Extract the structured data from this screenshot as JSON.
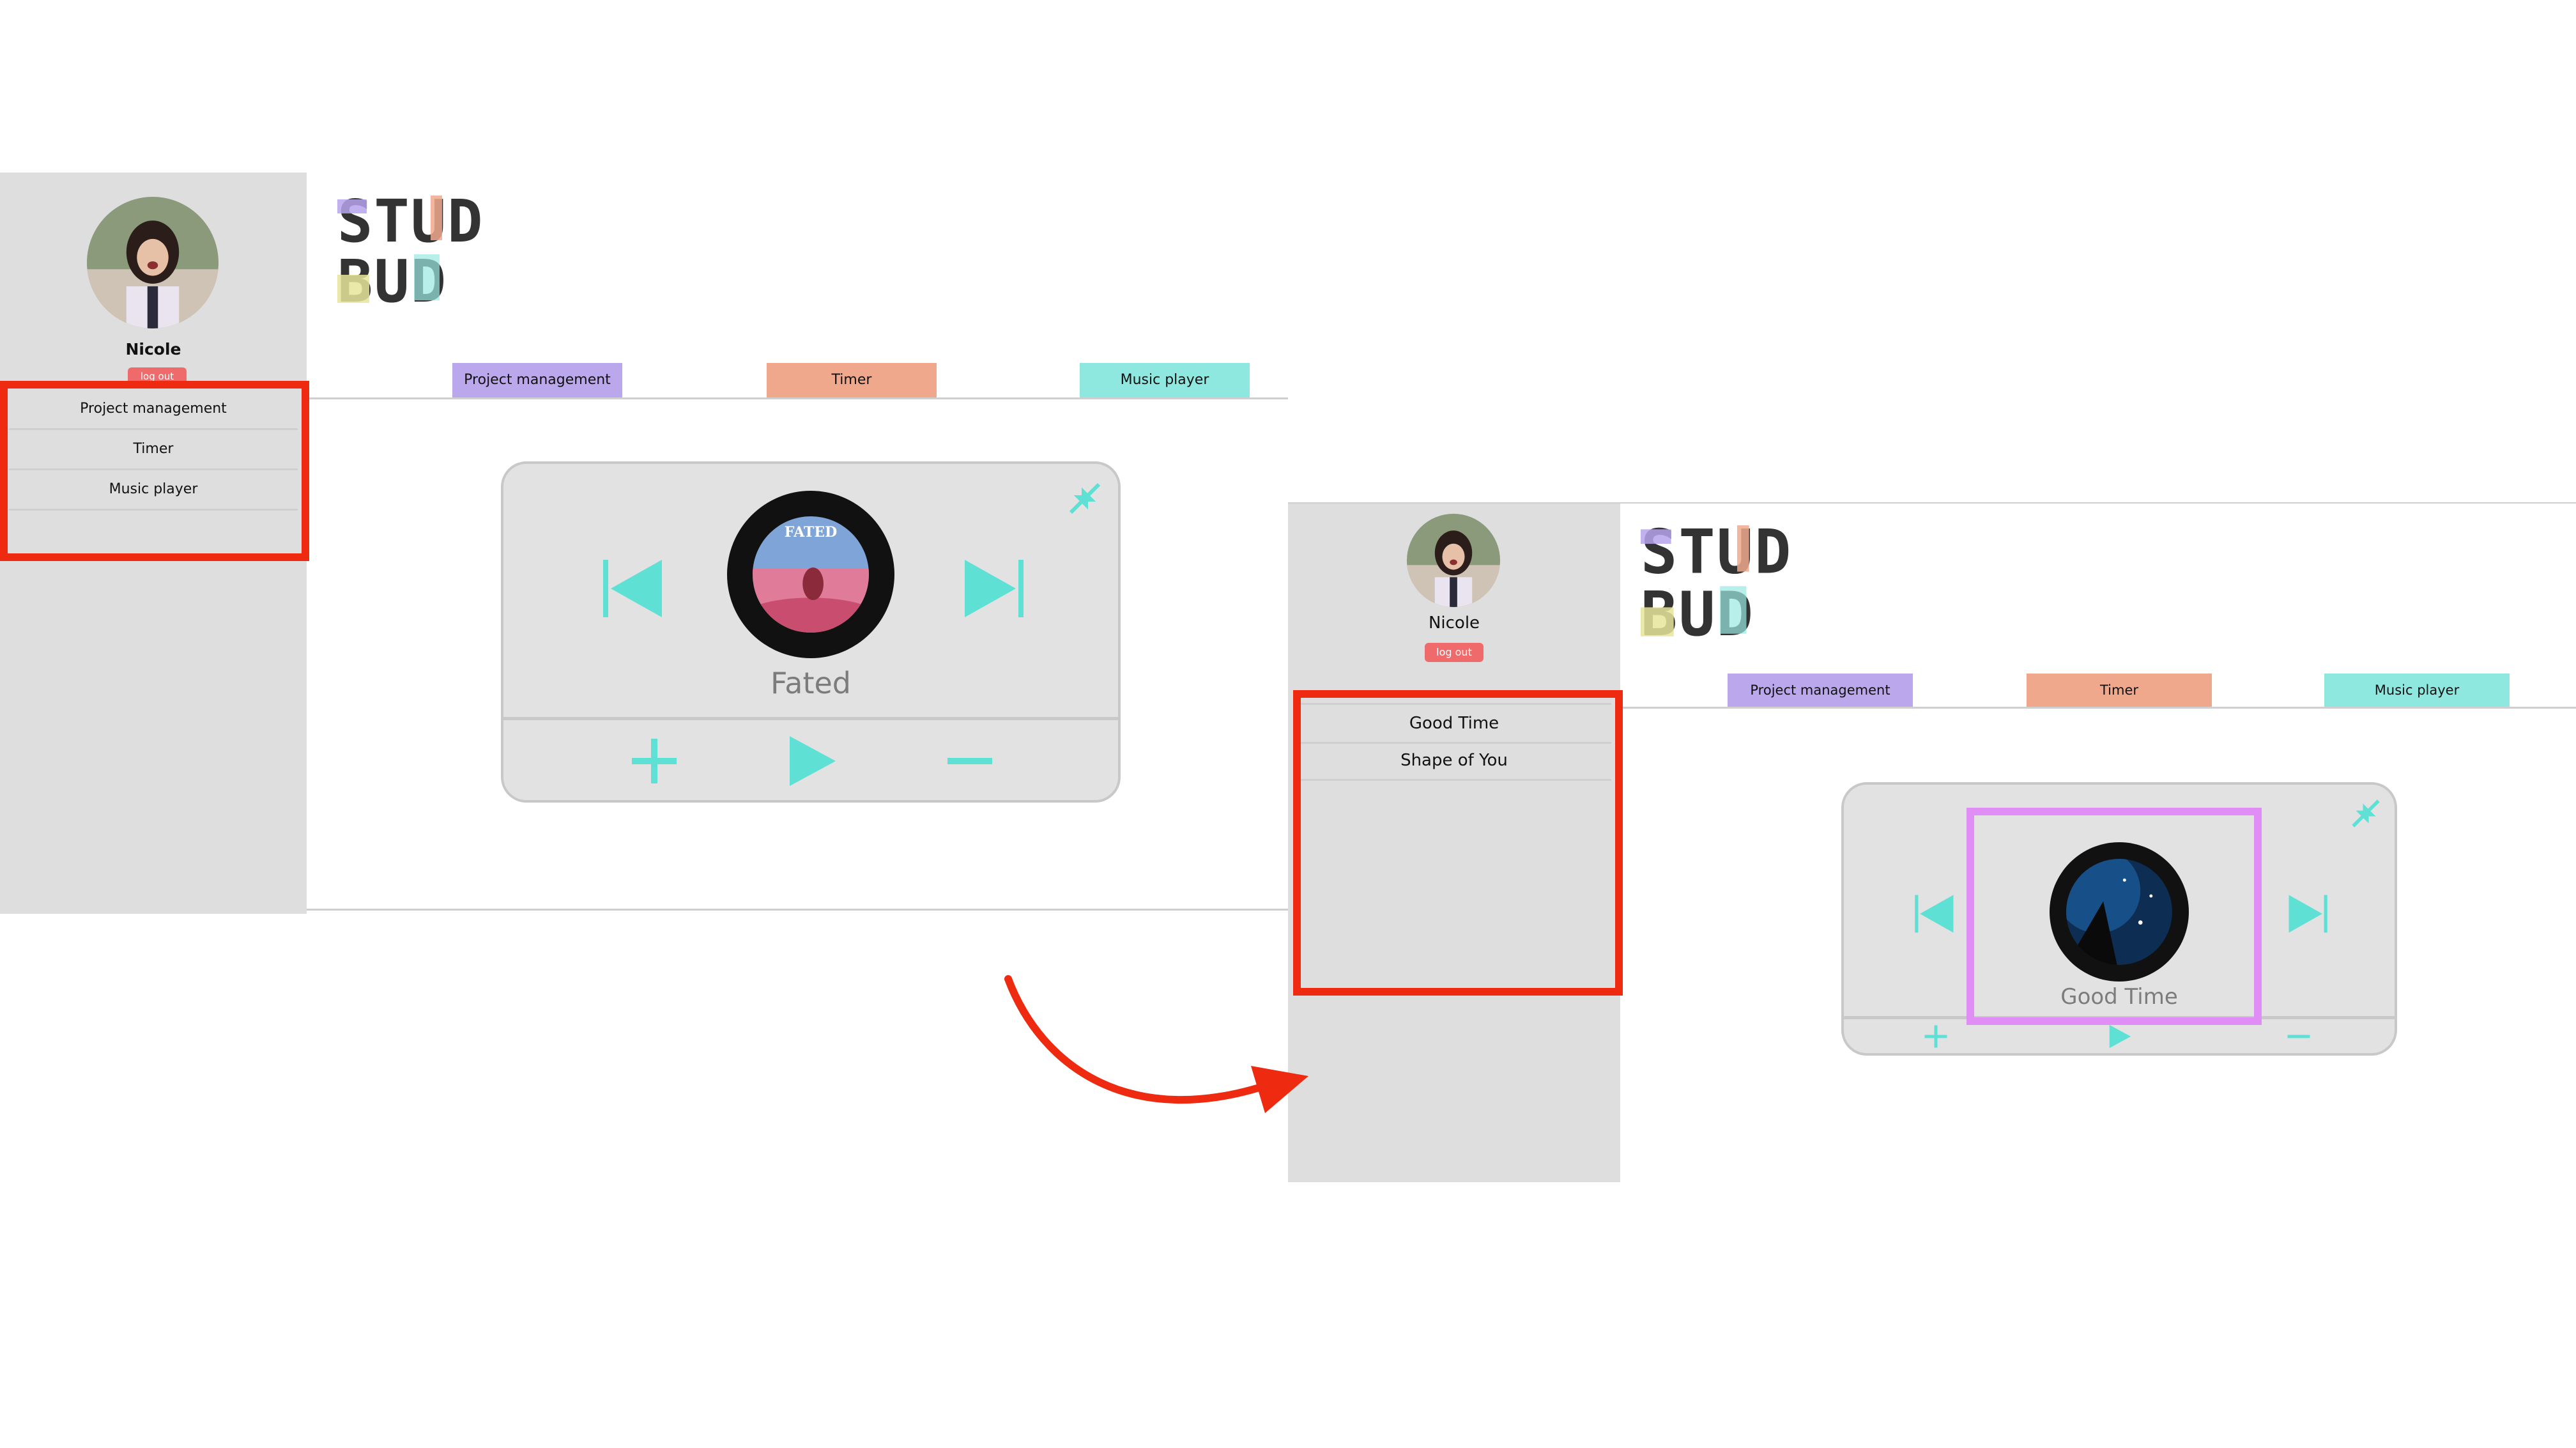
{
  "colors": {
    "sidebar_bg": "#dedede",
    "tab_project": "#bba7ec",
    "tab_timer": "#f0a88c",
    "tab_music": "#8ee8e0",
    "accent_teal": "#5fe0d4",
    "logout": "#ef6b6b",
    "annotation_red": "#ee2a10",
    "annotation_pink": "#e08ef5"
  },
  "before": {
    "user": {
      "name": "Nicole",
      "logout_label": "log out"
    },
    "tabs": [
      "Project management",
      "Timer",
      "Music player"
    ],
    "sidebar_menu": [
      "Project management",
      "Timer",
      "Music player"
    ],
    "player": {
      "track_title": "Fated",
      "cover_text": "FATED",
      "icons": [
        "previous-icon",
        "next-icon",
        "play-icon",
        "add-icon",
        "remove-icon",
        "minimize-icon"
      ]
    }
  },
  "after": {
    "user": {
      "name": "Nicole",
      "logout_label": "log out"
    },
    "tabs": [
      "Project management",
      "Timer",
      "Music player"
    ],
    "sidebar_menu": [
      "Good Time",
      "Shape of You"
    ],
    "player": {
      "track_title": "Good Time",
      "icons": [
        "previous-icon",
        "next-icon",
        "play-icon",
        "add-icon",
        "remove-icon",
        "minimize-icon"
      ]
    }
  }
}
